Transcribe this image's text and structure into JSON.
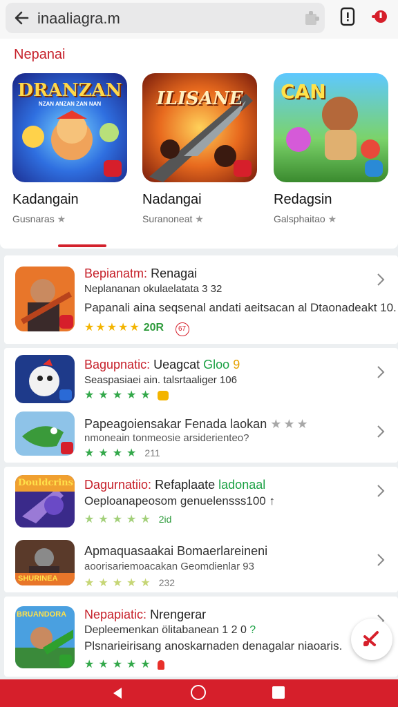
{
  "search": {
    "query": "inaaliagra.m"
  },
  "featured": {
    "title": "Nepanai",
    "cards": [
      {
        "art_text": "DRANZAN",
        "art_subtext": "NZAN ANZAN ZAN NAN",
        "title": "Kadangain",
        "subtitle": "Gusnaras",
        "star": "★"
      },
      {
        "art_text": "ILISANE",
        "title": "Nadangai",
        "subtitle": "Suranoneat",
        "star": "★"
      },
      {
        "art_text": "CAN",
        "title": "Redagsin",
        "subtitle": "Galsphaitao",
        "star": "★"
      }
    ]
  },
  "groups": [
    {
      "rows": [
        {
          "title_red": "Bepianatm:",
          "title_rest": " Renagai",
          "subtitle": "Neplananan okulaelatata 3 32",
          "description": "Papanali aina seqsenal andati  aeitsacan al Dtaonadeakt 10.",
          "stars": "★★★★★",
          "rating": "20R",
          "badge": "67"
        }
      ]
    },
    {
      "rows": [
        {
          "title_red": "Bagupnatic:",
          "title_rest": " Ueagcat",
          "title_green": "Gloo",
          "title_orange": "9",
          "subtitle": "Seaspasiaei ain. talsrtaaliger 106",
          "stars": "★★★★★"
        },
        {
          "title_rest": "Papeagoiensakar Fenada laokan",
          "title_stars": "★★★",
          "subtitle": "nmoneain tonmeosie arsiderienteo?",
          "stars": "★★★★",
          "num": "211"
        }
      ]
    },
    {
      "rows": [
        {
          "title_red": "Dagurnatiio:",
          "title_rest": " Refaplaate",
          "title_green": "ladonaal",
          "subtitle": "Oeploanapeosom genuelensss100 ↑",
          "stars": "★★★★★",
          "num": "2id"
        },
        {
          "title_rest": "Apmaquasaakai Bomaerlareineni",
          "subtitle": "aoorisariemoacakan Geomdienlar 93",
          "stars": "★★★★★",
          "num": "232"
        }
      ]
    },
    {
      "rows": [
        {
          "title_red": "Nepapiatic:",
          "title_rest": " Nrengerar",
          "subtitle": "Depleemenkan ölitabanean 1 2 0",
          "subtitle_green": "?",
          "description": "Plsnarieirisang anoskarnaden denagalar niaoaris.",
          "stars": "★★★★★"
        }
      ]
    }
  ],
  "colors": {
    "accent": "#d61f2b",
    "title_red": "#c6202a",
    "green": "#1aa043",
    "star_yellow": "#f3b400"
  },
  "icons": [
    "back-arrow-icon",
    "puzzle-icon",
    "phone-alert-icon",
    "notification-dot-icon",
    "chevron-right-icon",
    "compose-fab-icon"
  ]
}
